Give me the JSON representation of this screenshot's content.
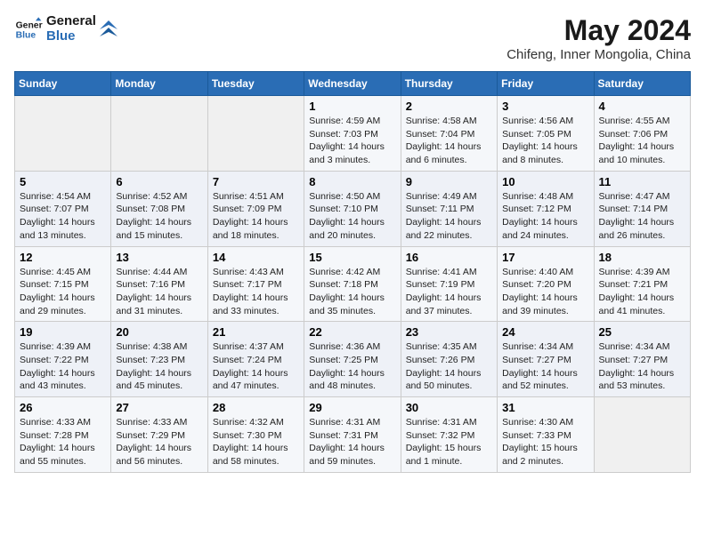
{
  "header": {
    "logo_general": "General",
    "logo_blue": "Blue",
    "month_year": "May 2024",
    "location": "Chifeng, Inner Mongolia, China"
  },
  "days_of_week": [
    "Sunday",
    "Monday",
    "Tuesday",
    "Wednesday",
    "Thursday",
    "Friday",
    "Saturday"
  ],
  "weeks": [
    [
      {
        "day": "",
        "info": ""
      },
      {
        "day": "",
        "info": ""
      },
      {
        "day": "",
        "info": ""
      },
      {
        "day": "1",
        "info": "Sunrise: 4:59 AM\nSunset: 7:03 PM\nDaylight: 14 hours and 3 minutes."
      },
      {
        "day": "2",
        "info": "Sunrise: 4:58 AM\nSunset: 7:04 PM\nDaylight: 14 hours and 6 minutes."
      },
      {
        "day": "3",
        "info": "Sunrise: 4:56 AM\nSunset: 7:05 PM\nDaylight: 14 hours and 8 minutes."
      },
      {
        "day": "4",
        "info": "Sunrise: 4:55 AM\nSunset: 7:06 PM\nDaylight: 14 hours and 10 minutes."
      }
    ],
    [
      {
        "day": "5",
        "info": "Sunrise: 4:54 AM\nSunset: 7:07 PM\nDaylight: 14 hours and 13 minutes."
      },
      {
        "day": "6",
        "info": "Sunrise: 4:52 AM\nSunset: 7:08 PM\nDaylight: 14 hours and 15 minutes."
      },
      {
        "day": "7",
        "info": "Sunrise: 4:51 AM\nSunset: 7:09 PM\nDaylight: 14 hours and 18 minutes."
      },
      {
        "day": "8",
        "info": "Sunrise: 4:50 AM\nSunset: 7:10 PM\nDaylight: 14 hours and 20 minutes."
      },
      {
        "day": "9",
        "info": "Sunrise: 4:49 AM\nSunset: 7:11 PM\nDaylight: 14 hours and 22 minutes."
      },
      {
        "day": "10",
        "info": "Sunrise: 4:48 AM\nSunset: 7:12 PM\nDaylight: 14 hours and 24 minutes."
      },
      {
        "day": "11",
        "info": "Sunrise: 4:47 AM\nSunset: 7:14 PM\nDaylight: 14 hours and 26 minutes."
      }
    ],
    [
      {
        "day": "12",
        "info": "Sunrise: 4:45 AM\nSunset: 7:15 PM\nDaylight: 14 hours and 29 minutes."
      },
      {
        "day": "13",
        "info": "Sunrise: 4:44 AM\nSunset: 7:16 PM\nDaylight: 14 hours and 31 minutes."
      },
      {
        "day": "14",
        "info": "Sunrise: 4:43 AM\nSunset: 7:17 PM\nDaylight: 14 hours and 33 minutes."
      },
      {
        "day": "15",
        "info": "Sunrise: 4:42 AM\nSunset: 7:18 PM\nDaylight: 14 hours and 35 minutes."
      },
      {
        "day": "16",
        "info": "Sunrise: 4:41 AM\nSunset: 7:19 PM\nDaylight: 14 hours and 37 minutes."
      },
      {
        "day": "17",
        "info": "Sunrise: 4:40 AM\nSunset: 7:20 PM\nDaylight: 14 hours and 39 minutes."
      },
      {
        "day": "18",
        "info": "Sunrise: 4:39 AM\nSunset: 7:21 PM\nDaylight: 14 hours and 41 minutes."
      }
    ],
    [
      {
        "day": "19",
        "info": "Sunrise: 4:39 AM\nSunset: 7:22 PM\nDaylight: 14 hours and 43 minutes."
      },
      {
        "day": "20",
        "info": "Sunrise: 4:38 AM\nSunset: 7:23 PM\nDaylight: 14 hours and 45 minutes."
      },
      {
        "day": "21",
        "info": "Sunrise: 4:37 AM\nSunset: 7:24 PM\nDaylight: 14 hours and 47 minutes."
      },
      {
        "day": "22",
        "info": "Sunrise: 4:36 AM\nSunset: 7:25 PM\nDaylight: 14 hours and 48 minutes."
      },
      {
        "day": "23",
        "info": "Sunrise: 4:35 AM\nSunset: 7:26 PM\nDaylight: 14 hours and 50 minutes."
      },
      {
        "day": "24",
        "info": "Sunrise: 4:34 AM\nSunset: 7:27 PM\nDaylight: 14 hours and 52 minutes."
      },
      {
        "day": "25",
        "info": "Sunrise: 4:34 AM\nSunset: 7:27 PM\nDaylight: 14 hours and 53 minutes."
      }
    ],
    [
      {
        "day": "26",
        "info": "Sunrise: 4:33 AM\nSunset: 7:28 PM\nDaylight: 14 hours and 55 minutes."
      },
      {
        "day": "27",
        "info": "Sunrise: 4:33 AM\nSunset: 7:29 PM\nDaylight: 14 hours and 56 minutes."
      },
      {
        "day": "28",
        "info": "Sunrise: 4:32 AM\nSunset: 7:30 PM\nDaylight: 14 hours and 58 minutes."
      },
      {
        "day": "29",
        "info": "Sunrise: 4:31 AM\nSunset: 7:31 PM\nDaylight: 14 hours and 59 minutes."
      },
      {
        "day": "30",
        "info": "Sunrise: 4:31 AM\nSunset: 7:32 PM\nDaylight: 15 hours and 1 minute."
      },
      {
        "day": "31",
        "info": "Sunrise: 4:30 AM\nSunset: 7:33 PM\nDaylight: 15 hours and 2 minutes."
      },
      {
        "day": "",
        "info": ""
      }
    ]
  ]
}
